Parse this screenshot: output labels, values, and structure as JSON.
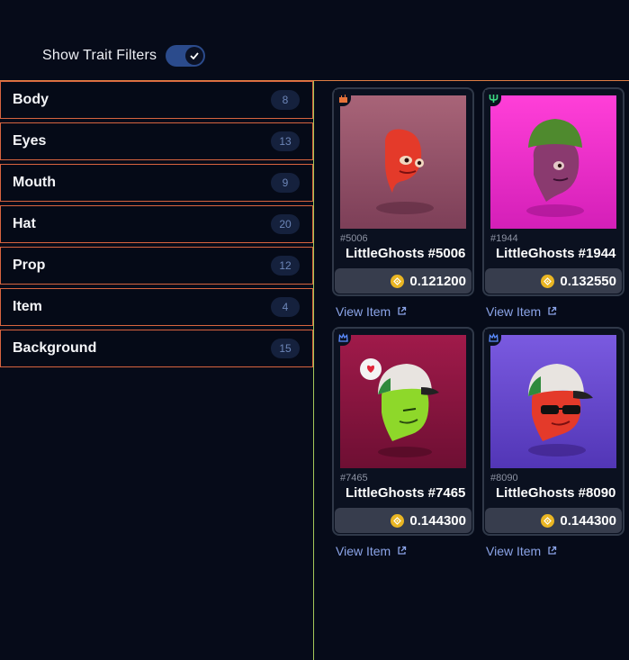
{
  "header": {
    "toggle_label": "Show Trait Filters",
    "toggle_on": true
  },
  "filters": [
    {
      "label": "Body",
      "count": "8"
    },
    {
      "label": "Eyes",
      "count": "13"
    },
    {
      "label": "Mouth",
      "count": "9"
    },
    {
      "label": "Hat",
      "count": "20"
    },
    {
      "label": "Prop",
      "count": "12"
    },
    {
      "label": "Item",
      "count": "4"
    },
    {
      "label": "Background",
      "count": "15"
    }
  ],
  "cards": [
    {
      "id": "#5006",
      "name": "LittleGhosts #5006",
      "price": "0.121200",
      "badge_icon": "castle-icon",
      "badge_color": "#e8733a",
      "bg": [
        "#a86478",
        "#7d3f58"
      ],
      "head": "#e43a2a",
      "hat": "none",
      "link": "View Item"
    },
    {
      "id": "#1944",
      "name": "LittleGhosts #1944",
      "price": "0.132550",
      "badge_icon": "trident-icon",
      "badge_color": "#3ddc84",
      "bg": [
        "#ff3fd8",
        "#d41fb8"
      ],
      "head": "#8a3a6f",
      "hat": "beanie",
      "link": "View Item"
    },
    {
      "id": "#7465",
      "name": "LittleGhosts #7465",
      "price": "0.144300",
      "badge_icon": "crown-icon",
      "badge_color": "#5b8cff",
      "bg": [
        "#a01a4a",
        "#6e0f33"
      ],
      "head": "#8ed82a",
      "hat": "cap",
      "link": "View Item"
    },
    {
      "id": "#8090",
      "name": "LittleGhosts #8090",
      "price": "0.144300",
      "badge_icon": "crown-icon",
      "badge_color": "#5b8cff",
      "bg": [
        "#7a5ae0",
        "#5236b6"
      ],
      "head": "#e43a2a",
      "hat": "cap",
      "link": "View Item"
    }
  ],
  "colors": {
    "background": "#060b19",
    "filter_border": "#d8643f",
    "divider": "#a4c65a",
    "link": "#8ba4e8",
    "coin": "#eab623"
  }
}
